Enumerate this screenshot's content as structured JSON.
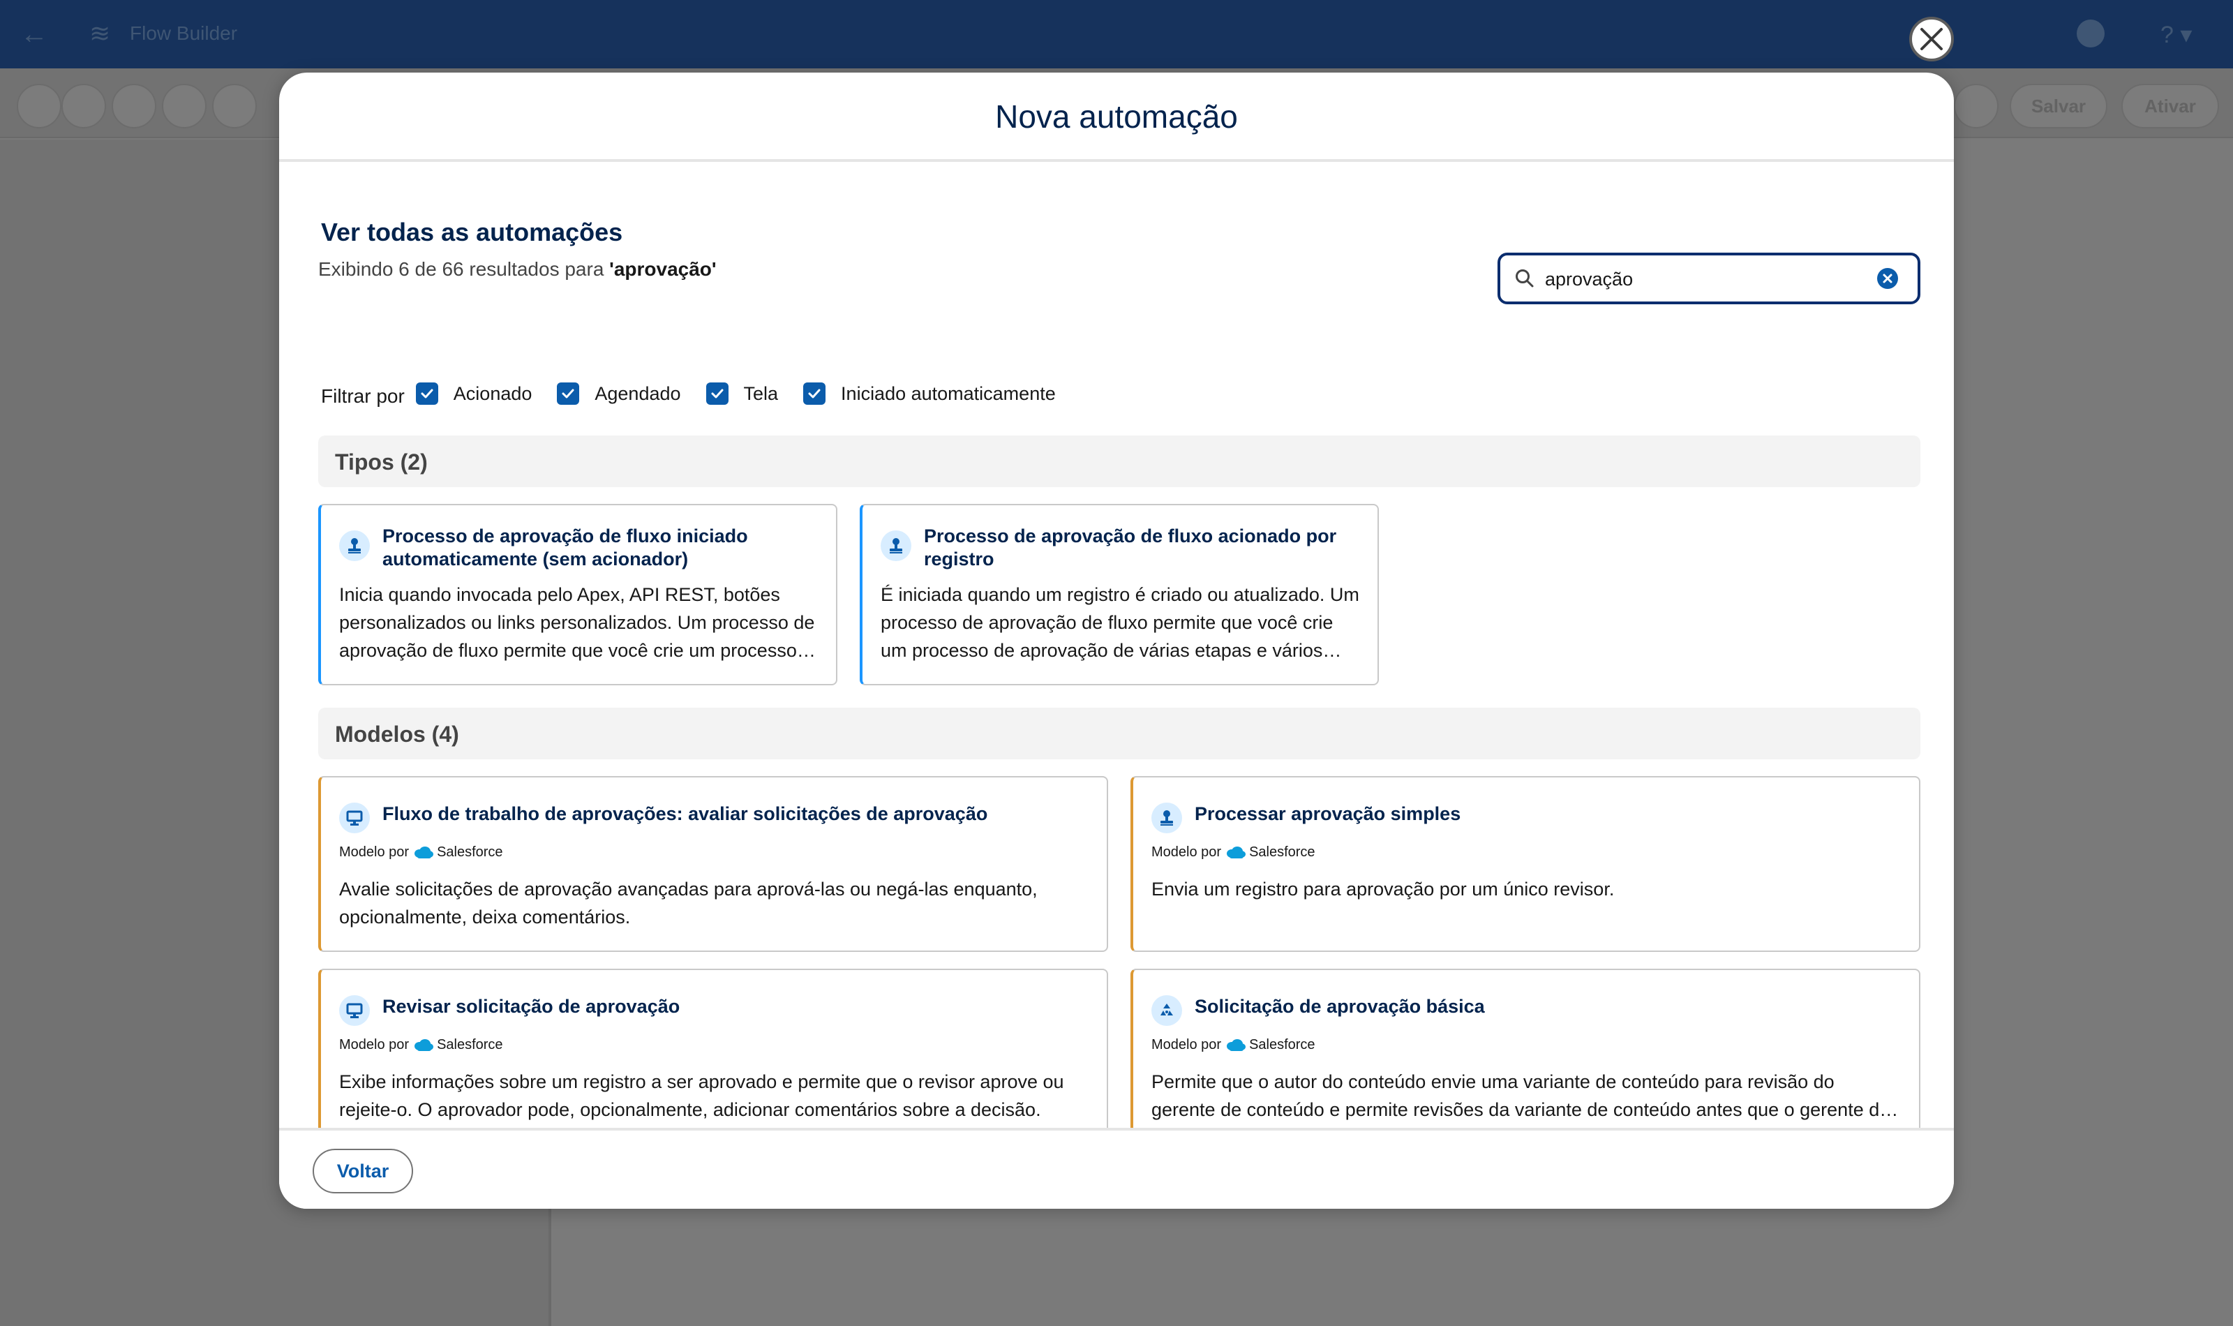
{
  "app": {
    "title": "Flow Builder",
    "save_label": "Salvar",
    "activate_label": "Ativar"
  },
  "modal": {
    "title": "Nova automação",
    "section_title": "Ver todas as automações",
    "results_prefix": "Exibindo 6 de 66 resultados para ",
    "results_query": "'aprovação'",
    "search": {
      "value": "aprovação",
      "icon": "search-icon"
    },
    "filter": {
      "label": "Filtrar por",
      "options": [
        {
          "label": "Acionado",
          "checked": true
        },
        {
          "label": "Agendado",
          "checked": true
        },
        {
          "label": "Tela",
          "checked": true
        },
        {
          "label": "Iniciado automaticamente",
          "checked": true
        }
      ]
    },
    "types_group": {
      "label": "Tipos (2)",
      "cards": [
        {
          "title": "Processo de aprovação de fluxo iniciado automaticamente (sem acionador)",
          "description": "Inicia quando invocada pelo Apex, API REST, botões personalizados ou links personalizados. Um processo de aprovação de fluxo permite que você crie um processo de aprovação de várias etapas e vários aprovadores.",
          "icon": "approval-stamp-icon"
        },
        {
          "title": "Processo de aprovação de fluxo acionado por registro",
          "description": "É iniciada quando um registro é criado ou atualizado. Um processo de aprovação de fluxo permite que você crie um processo de aprovação de várias etapas e vários aprovadores.",
          "icon": "approval-stamp-icon"
        }
      ]
    },
    "templates_group": {
      "label": "Modelos (4)",
      "meta_prefix": "Modelo por",
      "meta_vendor": "Salesforce",
      "cards": [
        {
          "title": "Fluxo de trabalho de aprovações: avaliar solicitações de aprovação",
          "description": "Avalie solicitações de aprovação avançadas para aprová-las ou negá-las enquanto, opcionalmente, deixa comentários.",
          "icon": "screen-icon"
        },
        {
          "title": "Processar aprovação simples",
          "description": "Envia um registro para aprovação por um único revisor.",
          "icon": "approval-stamp-icon"
        },
        {
          "title": "Revisar solicitação de aprovação",
          "description": "Exibe informações sobre um registro a ser aprovado e permite que o revisor aprove ou rejeite-o. O aprovador pode, opcionalmente, adicionar comentários sobre a decisão.",
          "icon": "screen-icon"
        },
        {
          "title": "Solicitação de aprovação básica",
          "description": "Permite que o autor do conteúdo envie uma variante de conteúdo para revisão do gerente de conteúdo e permite revisões da variante de conteúdo antes que o gerente de conteúdo a aprove.",
          "icon": "recycle-arrows-icon"
        }
      ]
    },
    "footer": {
      "back_label": "Voltar"
    }
  },
  "colors": {
    "accent": "#0b5cab",
    "title": "#03234d",
    "type_border": "#1b96ff",
    "template_border": "#dd9933",
    "header_bg": "#16325c"
  }
}
